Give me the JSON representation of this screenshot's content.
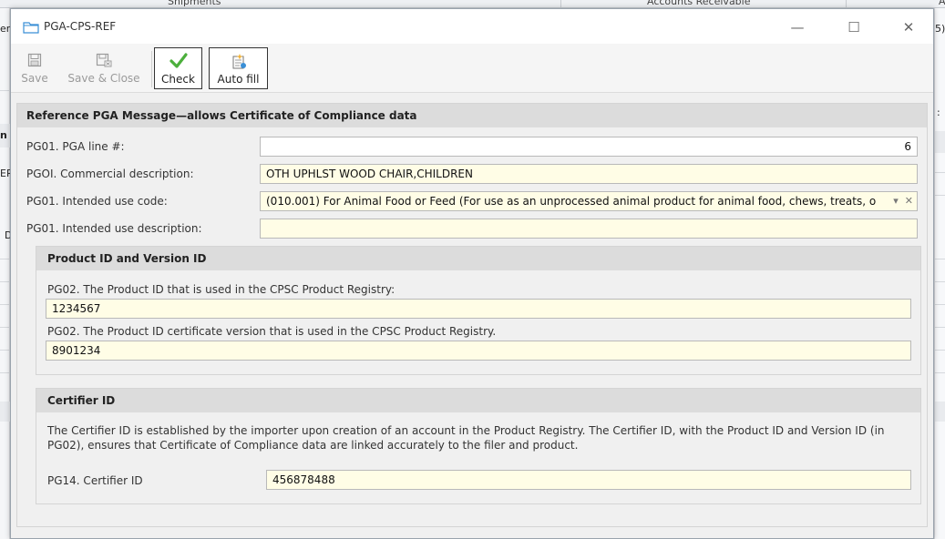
{
  "background": {
    "tabs": [
      "Shipments",
      "Accounts Receivable",
      "A"
    ],
    "frags": [
      "er",
      "n",
      "ER",
      "D",
      "5)",
      ":"
    ]
  },
  "dialog": {
    "title": "PGA-CPS-REF",
    "window_controls": {
      "minimize": "—",
      "maximize": "☐",
      "close": "✕"
    }
  },
  "toolbar": {
    "save_label": "Save",
    "save_close_label": "Save & Close",
    "check_label": "Check",
    "auto_fill_label": "Auto fill"
  },
  "main": {
    "header": "Reference PGA Message—allows Certificate of Compliance data",
    "fields": [
      {
        "label": "PG01. PGA line #:",
        "value": "6"
      },
      {
        "label": "PGOI. Commercial description:",
        "value": "OTH UPHLST WOOD CHAIR,CHILDREN"
      },
      {
        "label": "PG01. Intended use code:",
        "value": "(010.001) For Animal Food or Feed (For use as an unprocessed animal product for animal food, chews, treats, o"
      },
      {
        "label": "PG01. Intended use description:",
        "value": ""
      }
    ]
  },
  "product_section": {
    "header": "Product ID and Version ID",
    "product_id_label": "PG02. The Product ID that is used in the CPSC Product Registry:",
    "product_id_value": "1234567",
    "version_label": "PG02. The Product ID certificate version that is used in the CPSC Product Registry.",
    "version_value": "8901234"
  },
  "certifier_section": {
    "header": "Certifier ID",
    "description": "The Certifier ID is established by the importer upon creation of an account in the Product Registry. The Certifier ID, with the Product ID and Version ID (in PG02), ensures that Certificate of Compliance data are linked accurately to the filer and product.",
    "label": "PG14. Certifier ID",
    "value": "456878488"
  },
  "colors": {
    "field_bg": "#fffde6",
    "header_bg": "#dcdcdc",
    "check_green": "#4caf3c"
  }
}
